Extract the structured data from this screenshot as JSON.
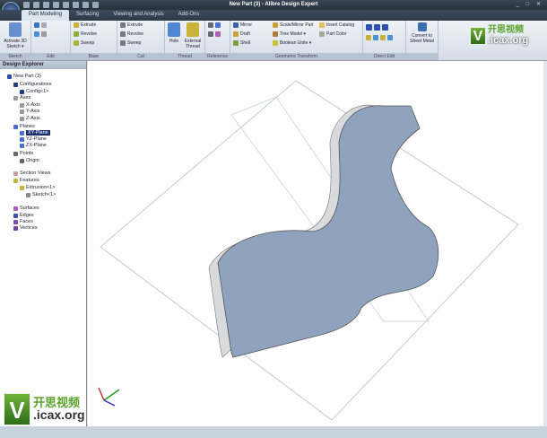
{
  "window": {
    "title": "New Part (3) - Alibre Design Expert",
    "controls": "_ □ ✕"
  },
  "tabs": [
    "Part Modeling",
    "Surfacing",
    "Viewing and Analysis",
    "Add-Ons"
  ],
  "ribbon": {
    "sketch": {
      "label": "Sketch",
      "activate": "Activate 3D Sketch ▾"
    },
    "edit": {
      "label": "Edit"
    },
    "base": {
      "label": "Base",
      "items": [
        "Extrude",
        "Revolve",
        "Sweep"
      ]
    },
    "cut": {
      "label": "Cut",
      "items": [
        "Extrude",
        "Revolve",
        "Sweep"
      ]
    },
    "thread": {
      "label": "Thread",
      "hole": "Hole",
      "external": "External Thread"
    },
    "reference": {
      "label": "Reference"
    },
    "geo": {
      "label": "Geometric Transform",
      "items": [
        "Mirror",
        "Draft",
        "Shell",
        "Scale/Mirror Part",
        "Tree Model ▾",
        "Boolean Unite ▾",
        "Insert Catalog",
        "Part Color"
      ]
    },
    "direct": {
      "label": "Direct Edit"
    },
    "convert": {
      "label": "Convert to Sheet Metal"
    }
  },
  "explorer": {
    "title": "Design Explorer",
    "nodes": [
      "New Part (3)",
      "Configurations",
      "Config<1>",
      "Axes",
      "X-Axis",
      "Y-Axis",
      "Z-Axis",
      "Planes",
      "XY-Plane",
      "YZ-Plane",
      "ZX-Plane",
      "Points",
      "Origin",
      "Section Views",
      "Features",
      "Extrusion<1>",
      "Sketch<1>",
      "Surfaces",
      "Edges",
      "Faces",
      "Vertices"
    ]
  },
  "watermark": {
    "cn": "开思视频",
    "site": ".icax.org",
    "v": "V"
  }
}
